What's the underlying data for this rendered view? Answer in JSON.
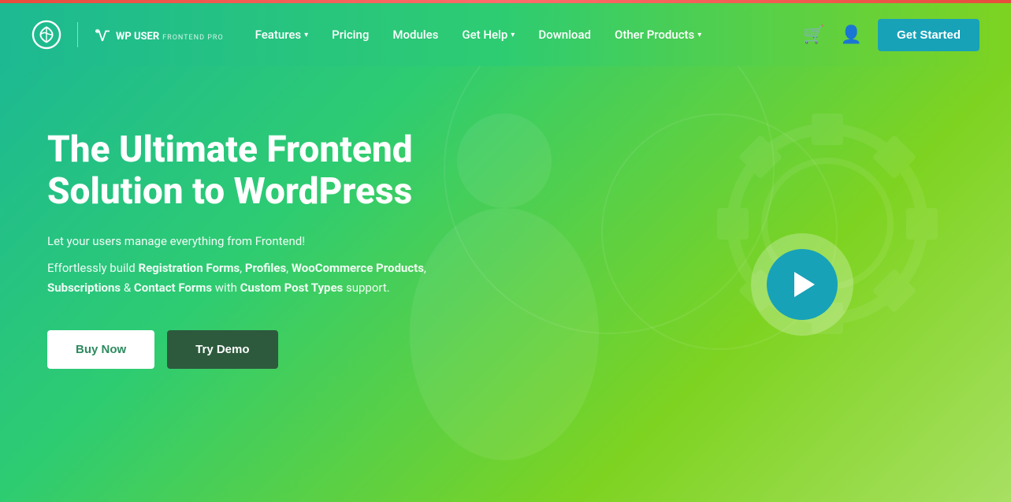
{
  "topbar": {},
  "navbar": {
    "logo_brand": "WP USER",
    "logo_sub": "FRONTEND PRO",
    "nav_items": [
      {
        "label": "Features",
        "has_dropdown": true
      },
      {
        "label": "Pricing",
        "has_dropdown": false
      },
      {
        "label": "Modules",
        "has_dropdown": false
      },
      {
        "label": "Get Help",
        "has_dropdown": true
      },
      {
        "label": "Download",
        "has_dropdown": false
      },
      {
        "label": "Other Products",
        "has_dropdown": true
      }
    ],
    "get_started_label": "Get Started"
  },
  "hero": {
    "title_line1": "The Ultimate Frontend",
    "title_line2": "Solution to WordPress",
    "subtitle": "Let your users manage everything from Frontend!",
    "desc_prefix": "Effortlessly build ",
    "desc_bold1": "Registration Forms",
    "desc_sep1": ", ",
    "desc_bold2": "Profiles",
    "desc_sep2": ", ",
    "desc_bold3": "WooCommerce Products",
    "desc_sep3": ", ",
    "desc_bold4": "Subscriptions",
    "desc_mid": " & ",
    "desc_bold5": "Contact Forms",
    "desc_suffix": " with ",
    "desc_bold6": "Custom Post Types",
    "desc_end": " support.",
    "btn_buy_now": "Buy Now",
    "btn_try_demo": "Try Demo"
  }
}
